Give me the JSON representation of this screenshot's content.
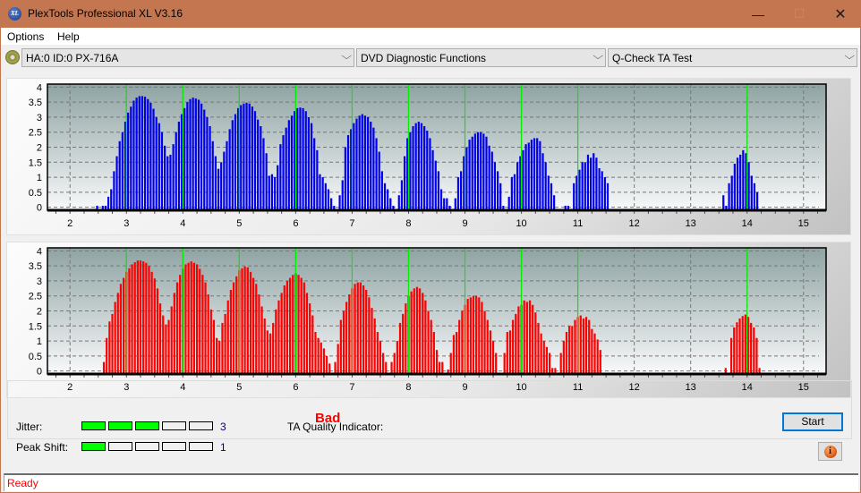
{
  "window": {
    "title": "PlexTools Professional XL V3.16",
    "app_icon_text": "XL",
    "controls": {
      "minimize": "—",
      "maximize": "☐",
      "close": "✕"
    }
  },
  "menu": {
    "items": [
      {
        "label": "Options"
      },
      {
        "label": "Help"
      }
    ]
  },
  "toolbar": {
    "drive_select": {
      "value": "HA:0 ID:0  PX-716A"
    },
    "function_select": {
      "value": "DVD Diagnostic Functions"
    },
    "test_select": {
      "value": "Q-Check TA Test"
    },
    "chevron": "⌵"
  },
  "colors": {
    "top_bars": "#0000ee",
    "bottom_bars": "#ff0000",
    "marker_lines": "#00ee00",
    "meter_on": "#00ff00",
    "quality_bad": "#ff0000"
  },
  "chart_data": [
    {
      "type": "bar",
      "name": "top-chart",
      "title": "",
      "xlabel": "",
      "ylabel": "",
      "xlim": [
        1.6,
        15.4
      ],
      "ylim": [
        -0.1,
        4.1
      ],
      "xticks": [
        "2",
        "3",
        "4",
        "5",
        "6",
        "7",
        "8",
        "9",
        "10",
        "11",
        "12",
        "13",
        "14",
        "15"
      ],
      "yticks": [
        "0",
        "0.5",
        "1",
        "1.5",
        "2",
        "2.5",
        "3",
        "3.5",
        "4"
      ],
      "grid": true,
      "marker_lines_x": [
        3,
        4,
        5,
        6,
        7,
        8,
        9,
        10,
        11,
        14
      ],
      "color": "#0000ee",
      "bar_x_start": 2.48,
      "bar_x_step": 0.05,
      "values": [
        0.05,
        0,
        0.05,
        0.05,
        0.35,
        0.6,
        1.2,
        1.7,
        2.2,
        2.5,
        2.85,
        3.15,
        3.35,
        3.55,
        3.65,
        3.7,
        3.7,
        3.68,
        3.6,
        3.48,
        3.28,
        3.0,
        2.8,
        2.5,
        2.05,
        1.7,
        1.75,
        2.1,
        2.5,
        2.85,
        3.1,
        3.3,
        3.5,
        3.6,
        3.65,
        3.62,
        3.58,
        3.45,
        3.25,
        3.0,
        2.7,
        2.2,
        1.7,
        1.28,
        1.5,
        1.85,
        2.2,
        2.6,
        2.9,
        3.1,
        3.3,
        3.4,
        3.45,
        3.48,
        3.45,
        3.35,
        3.2,
        2.92,
        2.7,
        2.3,
        1.8,
        1.05,
        1.1,
        1.0,
        1.4,
        2.1,
        2.4,
        2.65,
        2.9,
        3.05,
        3.2,
        3.3,
        3.32,
        3.3,
        3.2,
        3.0,
        2.8,
        2.3,
        1.9,
        1.1,
        1.0,
        0.8,
        0.6,
        0.3,
        0.05,
        0.0,
        0.4,
        0.9,
        2.0,
        2.4,
        2.6,
        2.8,
        2.95,
        3.05,
        3.1,
        3.05,
        3.0,
        2.85,
        2.65,
        2.3,
        1.85,
        1.2,
        0.8,
        0.6,
        0.3,
        0.05,
        0.0,
        0.4,
        0.9,
        1.7,
        2.3,
        2.5,
        2.7,
        2.8,
        2.85,
        2.8,
        2.7,
        2.55,
        2.3,
        1.9,
        1.55,
        1.2,
        0.6,
        0.3,
        0.3,
        0.05,
        0.0,
        0.3,
        1.0,
        1.2,
        1.7,
        2.0,
        2.25,
        2.35,
        2.45,
        2.5,
        2.5,
        2.45,
        2.35,
        2.05,
        1.85,
        1.5,
        1.2,
        0.8,
        0.05,
        0.0,
        0.35,
        1.0,
        1.1,
        1.5,
        1.7,
        1.9,
        2.1,
        2.15,
        2.25,
        2.3,
        2.3,
        2.2,
        1.8,
        1.5,
        1.05,
        0.8,
        0.4,
        0.0,
        0.0,
        0.0,
        0.05,
        0.05,
        0.0,
        0.8,
        1.05,
        1.25,
        1.5,
        1.5,
        1.75,
        1.65,
        1.8,
        1.65,
        1.3,
        1.2,
        1.0,
        0.8
      ],
      "cluster14": {
        "bar_x_start": 13.58,
        "bar_x_step": 0.05,
        "values": [
          0.4,
          0.05,
          0.8,
          1.05,
          1.45,
          1.65,
          1.75,
          1.9,
          1.8,
          1.5,
          1.05,
          0.8,
          0.5
        ]
      }
    },
    {
      "type": "bar",
      "name": "bottom-chart",
      "title": "",
      "xlabel": "",
      "ylabel": "",
      "xlim": [
        1.6,
        15.4
      ],
      "ylim": [
        -0.1,
        4.1
      ],
      "xticks": [
        "2",
        "3",
        "4",
        "5",
        "6",
        "7",
        "8",
        "9",
        "10",
        "11",
        "12",
        "13",
        "14",
        "15"
      ],
      "yticks": [
        "0",
        "0.5",
        "1",
        "1.5",
        "2",
        "2.5",
        "3",
        "3.5",
        "4"
      ],
      "grid": true,
      "marker_lines_x": [
        3,
        4,
        5,
        6,
        7,
        8,
        9,
        10,
        11,
        14
      ],
      "color": "#ff0000",
      "bar_x_start": 2.6,
      "bar_x_step": 0.05,
      "values": [
        0.3,
        1.1,
        1.65,
        1.9,
        2.3,
        2.6,
        2.9,
        3.1,
        3.3,
        3.42,
        3.55,
        3.62,
        3.68,
        3.68,
        3.65,
        3.6,
        3.5,
        3.3,
        3.08,
        2.75,
        2.25,
        1.85,
        1.55,
        1.7,
        2.15,
        2.6,
        2.95,
        3.2,
        3.4,
        3.55,
        3.6,
        3.65,
        3.6,
        3.55,
        3.4,
        3.2,
        2.95,
        2.55,
        2.05,
        1.7,
        1.1,
        1.0,
        1.6,
        1.9,
        2.35,
        2.7,
        2.95,
        3.15,
        3.35,
        3.42,
        3.48,
        3.45,
        3.3,
        3.1,
        2.9,
        2.55,
        2.15,
        1.75,
        1.35,
        1.25,
        1.6,
        2.05,
        2.35,
        2.6,
        2.85,
        3.0,
        3.1,
        3.2,
        3.25,
        3.2,
        3.1,
        2.95,
        2.6,
        2.25,
        1.85,
        1.3,
        1.1,
        0.95,
        0.75,
        0.5,
        0.25,
        0.0,
        0.3,
        0.9,
        1.7,
        2.0,
        2.3,
        2.55,
        2.75,
        2.9,
        2.95,
        2.95,
        2.85,
        2.7,
        2.45,
        2.1,
        1.75,
        1.3,
        1.0,
        0.6,
        0.3,
        0.0,
        0.3,
        0.6,
        1.0,
        1.6,
        1.9,
        2.25,
        2.5,
        2.65,
        2.75,
        2.8,
        2.75,
        2.6,
        2.35,
        2.0,
        1.7,
        1.3,
        0.7,
        0.3,
        0.3,
        0.0,
        0.05,
        0.6,
        1.2,
        1.3,
        1.7,
        2.0,
        2.2,
        2.4,
        2.45,
        2.5,
        2.5,
        2.45,
        2.3,
        2.0,
        1.7,
        1.35,
        1.0,
        0.6,
        0.0,
        0.0,
        0.6,
        1.3,
        1.35,
        1.7,
        1.9,
        2.15,
        2.2,
        2.35,
        2.3,
        2.35,
        2.2,
        1.95,
        1.6,
        1.25,
        1.0,
        0.8,
        0.6,
        0.1,
        0.1,
        0.0,
        0.6,
        1.0,
        1.3,
        1.5,
        1.5,
        1.7,
        1.8,
        1.85,
        1.75,
        1.8,
        1.7,
        1.4,
        1.25,
        1.05,
        0.7
      ],
      "cluster14": {
        "bar_x_start": 13.62,
        "bar_x_step": 0.05,
        "values": [
          0.1,
          0.0,
          1.1,
          1.45,
          1.62,
          1.75,
          1.83,
          1.88,
          1.8,
          1.6,
          1.45,
          1.1,
          0.1
        ]
      }
    }
  ],
  "results": {
    "jitter": {
      "label": "Jitter:",
      "value": "3",
      "segments_total": 5,
      "segments_on": 3
    },
    "peak_shift": {
      "label": "Peak Shift:",
      "value": "1",
      "segments_total": 5,
      "segments_on": 1
    },
    "ta_quality": {
      "label": "TA Quality Indicator:",
      "value": "Bad"
    }
  },
  "buttons": {
    "start": "Start",
    "info": "i"
  },
  "status": {
    "text": "Ready"
  }
}
